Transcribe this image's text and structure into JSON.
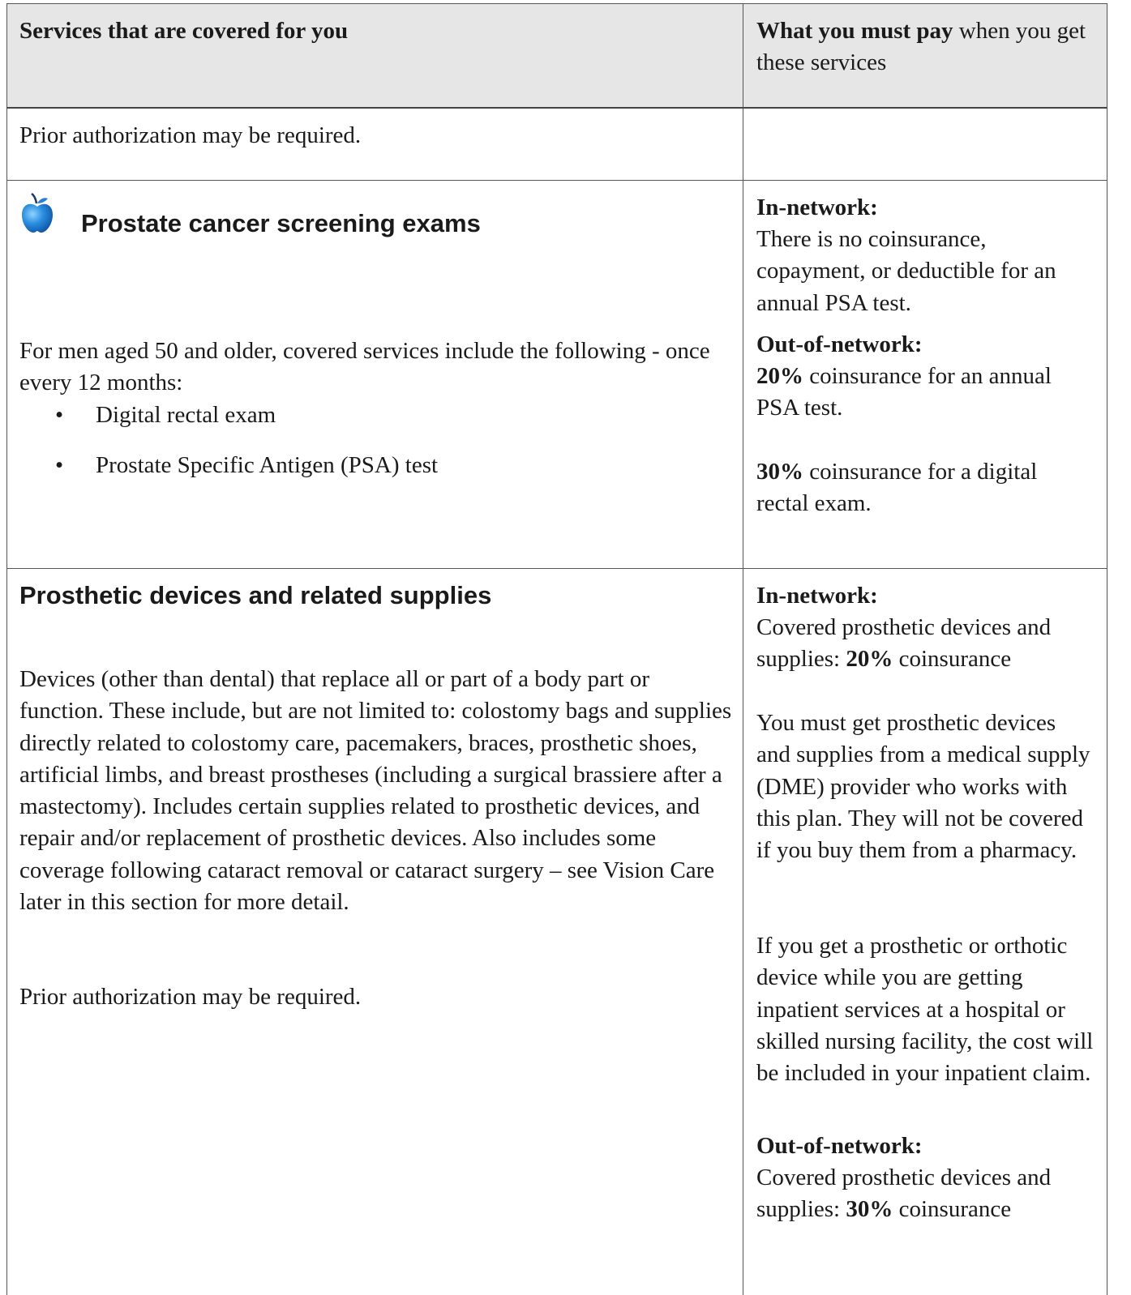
{
  "header": {
    "col1": "Services that are covered for you",
    "col2_bold": "What you must pay",
    "col2_rest": " when you get these services"
  },
  "row0": {
    "left_text": "Prior authorization may be required."
  },
  "row1": {
    "icon": "apple-icon",
    "title": "Prostate cancer screening exams",
    "intro": "For men aged 50 and older, covered services include the following - once every 12 months:",
    "bullets": [
      "Digital rectal exam",
      "Prostate Specific Antigen (PSA) test"
    ],
    "in_label": "In-network:",
    "in_text": "There is no coinsurance, copayment, or deductible for an annual PSA test.",
    "out_label": "Out-of-network:",
    "out_pct1": "20%",
    "out_text1": " coinsurance for an annual PSA test.",
    "out_pct2": "30%",
    "out_text2": " coinsurance for a digital rectal exam."
  },
  "row2": {
    "title": "Prosthetic devices and related supplies",
    "body": "Devices (other than dental) that replace all or part of a body part or function. These include, but are not limited to: colostomy bags and supplies directly related to colostomy care, pacemakers, braces, prosthetic shoes, artificial limbs, and breast prostheses (including a surgical brassiere after a mastectomy). Includes certain supplies related to prosthetic devices, and repair and/or replacement of prosthetic devices. Also includes some coverage following cataract removal or cataract surgery – see Vision Care later in this section for more detail.",
    "note": "Prior authorization may be required.",
    "in_label": "In-network:",
    "in_line_a": "Covered prosthetic devices and supplies: ",
    "in_pct": "20%",
    "in_line_b": " coinsurance",
    "in_para2": "You must get prosthetic devices and supplies from a medical supply (DME) provider who works with this plan. They will not be covered if you buy them from a pharmacy.",
    "in_para3": "If you get a prosthetic or orthotic device while you are getting inpatient services at a hospital or skilled nursing facility, the cost will be included in your inpatient claim.",
    "out_label": "Out-of-network:",
    "out_line_a": "Covered prosthetic devices and supplies: ",
    "out_pct": "30%",
    "out_line_b": " coinsurance"
  }
}
